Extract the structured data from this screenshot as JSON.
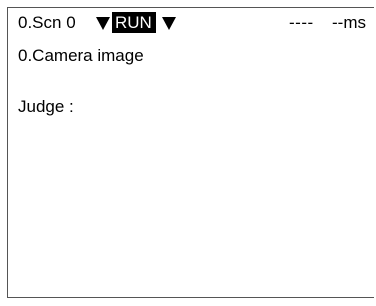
{
  "status_bar": {
    "scene_label": "0.Scn 0",
    "scene_dropdown_icon": "triangle-down-icon",
    "mode_label": "RUN",
    "mode_dropdown_icon": "triangle-down-icon",
    "time_value": "----",
    "time_unit": "--ms"
  },
  "main": {
    "image_title": "0.Camera image",
    "judge_label": "Judge :"
  },
  "colors": {
    "background": "#ffffff",
    "text": "#000000",
    "badge_background": "#000000",
    "badge_text": "#ffffff",
    "border": "#555555"
  }
}
